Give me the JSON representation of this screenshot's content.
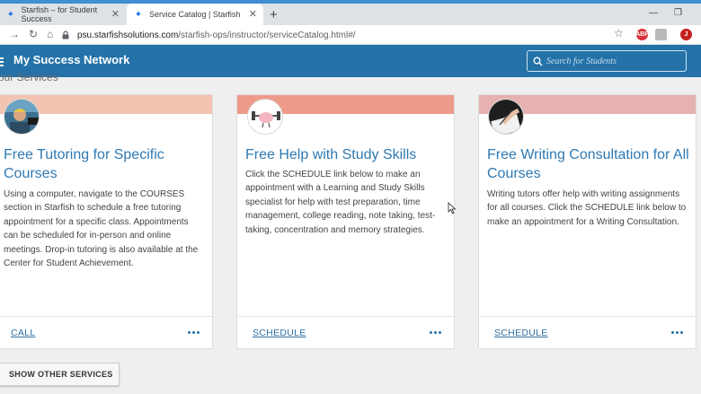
{
  "browser": {
    "tabs": [
      {
        "title": "Starfish – for Student Success",
        "active": false
      },
      {
        "title": "Service Catalog | Starfish",
        "active": true
      }
    ],
    "address": {
      "host": "psu.starfishsolutions.com",
      "path": "/starfish-ops/instructor/serviceCatalog.html#/"
    },
    "extensions": {
      "abp": "ABP",
      "profile": "J"
    },
    "colors": {
      "accent_strip": "#3f8fd2",
      "abp": "#d6333a",
      "profile": "#c5221f"
    }
  },
  "app": {
    "title": "My Success Network",
    "search_placeholder": "Search for Students",
    "header_color": "#2472a8"
  },
  "section": {
    "title": "our Services",
    "show_other_label": "SHOW OTHER SERVICES"
  },
  "cards": [
    {
      "title": "Free Tutoring for Specific Courses",
      "description": "Using a computer, navigate to the COURSES section in Starfish to schedule a free tutoring appointment for a specific class. Appointments can be scheduled for in-person and online meetings. Drop-in tutoring is also available at the Center for Student Achievement.",
      "action": "CALL",
      "band_color": "#f2c3b1",
      "avatar_icon": "tutoring-photo-icon"
    },
    {
      "title": "Free Help with Study Skills",
      "description": "Click the SCHEDULE link below to make an appointment with a Learning and Study Skills specialist for help with test preparation, time management, college reading, note taking, test-taking, concentration and memory strategies.",
      "action": "SCHEDULE",
      "band_color": "#ee9a8a",
      "avatar_icon": "brain-weightlifting-icon"
    },
    {
      "title": "Free Writing Consultation for All Courses",
      "description": "Writing tutors offer help with writing assignments for all courses. Click the SCHEDULE link below to make an appointment for a Writing Consultation.",
      "action": "SCHEDULE",
      "band_color": "#e6b1b1",
      "avatar_icon": "writing-hand-icon"
    }
  ]
}
